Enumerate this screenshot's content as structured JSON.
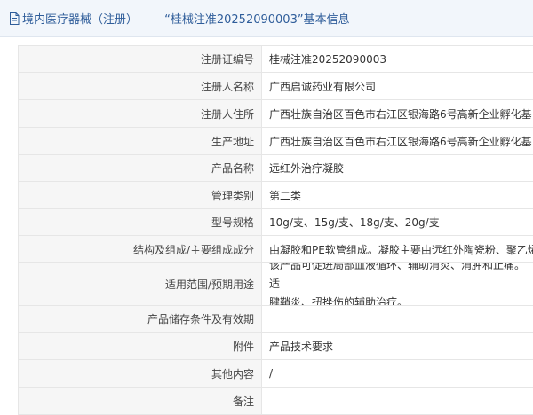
{
  "header": {
    "title": "境内医疗器械（注册）  ——“桂械注准20252090003”基本信息"
  },
  "rows": [
    {
      "label": "注册证编号",
      "value": "桂械注准20252090003"
    },
    {
      "label": "注册人名称",
      "value": "广西启诚药业有限公司"
    },
    {
      "label": "注册人住所",
      "value": "广西壮族自治区百色市右江区银海路6号高新企业孵化基"
    },
    {
      "label": "生产地址",
      "value": "广西壮族自治区百色市右江区银海路6号高新企业孵化基"
    },
    {
      "label": "产品名称",
      "value": "远红外治疗凝胶"
    },
    {
      "label": "管理类别",
      "value": "第二类"
    },
    {
      "label": "型号规格",
      "value": "10g/支、15g/支、18g/支、20g/支"
    },
    {
      "label": "结构及组成/主要组成成分",
      "value": "由凝胶和PE软管组成。凝胶主要由远红外陶瓷粉、聚乙烯"
    },
    {
      "label": "适用范围/预期用途",
      "value_line1": "该产品可促进局部血液循环、辅助消炎、消肿和止痛。适",
      "value_line2": "腱鞘炎、扭挫伤的辅助治疗。"
    },
    {
      "label": "产品储存条件及有效期",
      "value": ""
    },
    {
      "label": "附件",
      "value": "产品技术要求"
    },
    {
      "label": "其他内容",
      "value": "/"
    },
    {
      "label": "备注",
      "value": ""
    }
  ]
}
